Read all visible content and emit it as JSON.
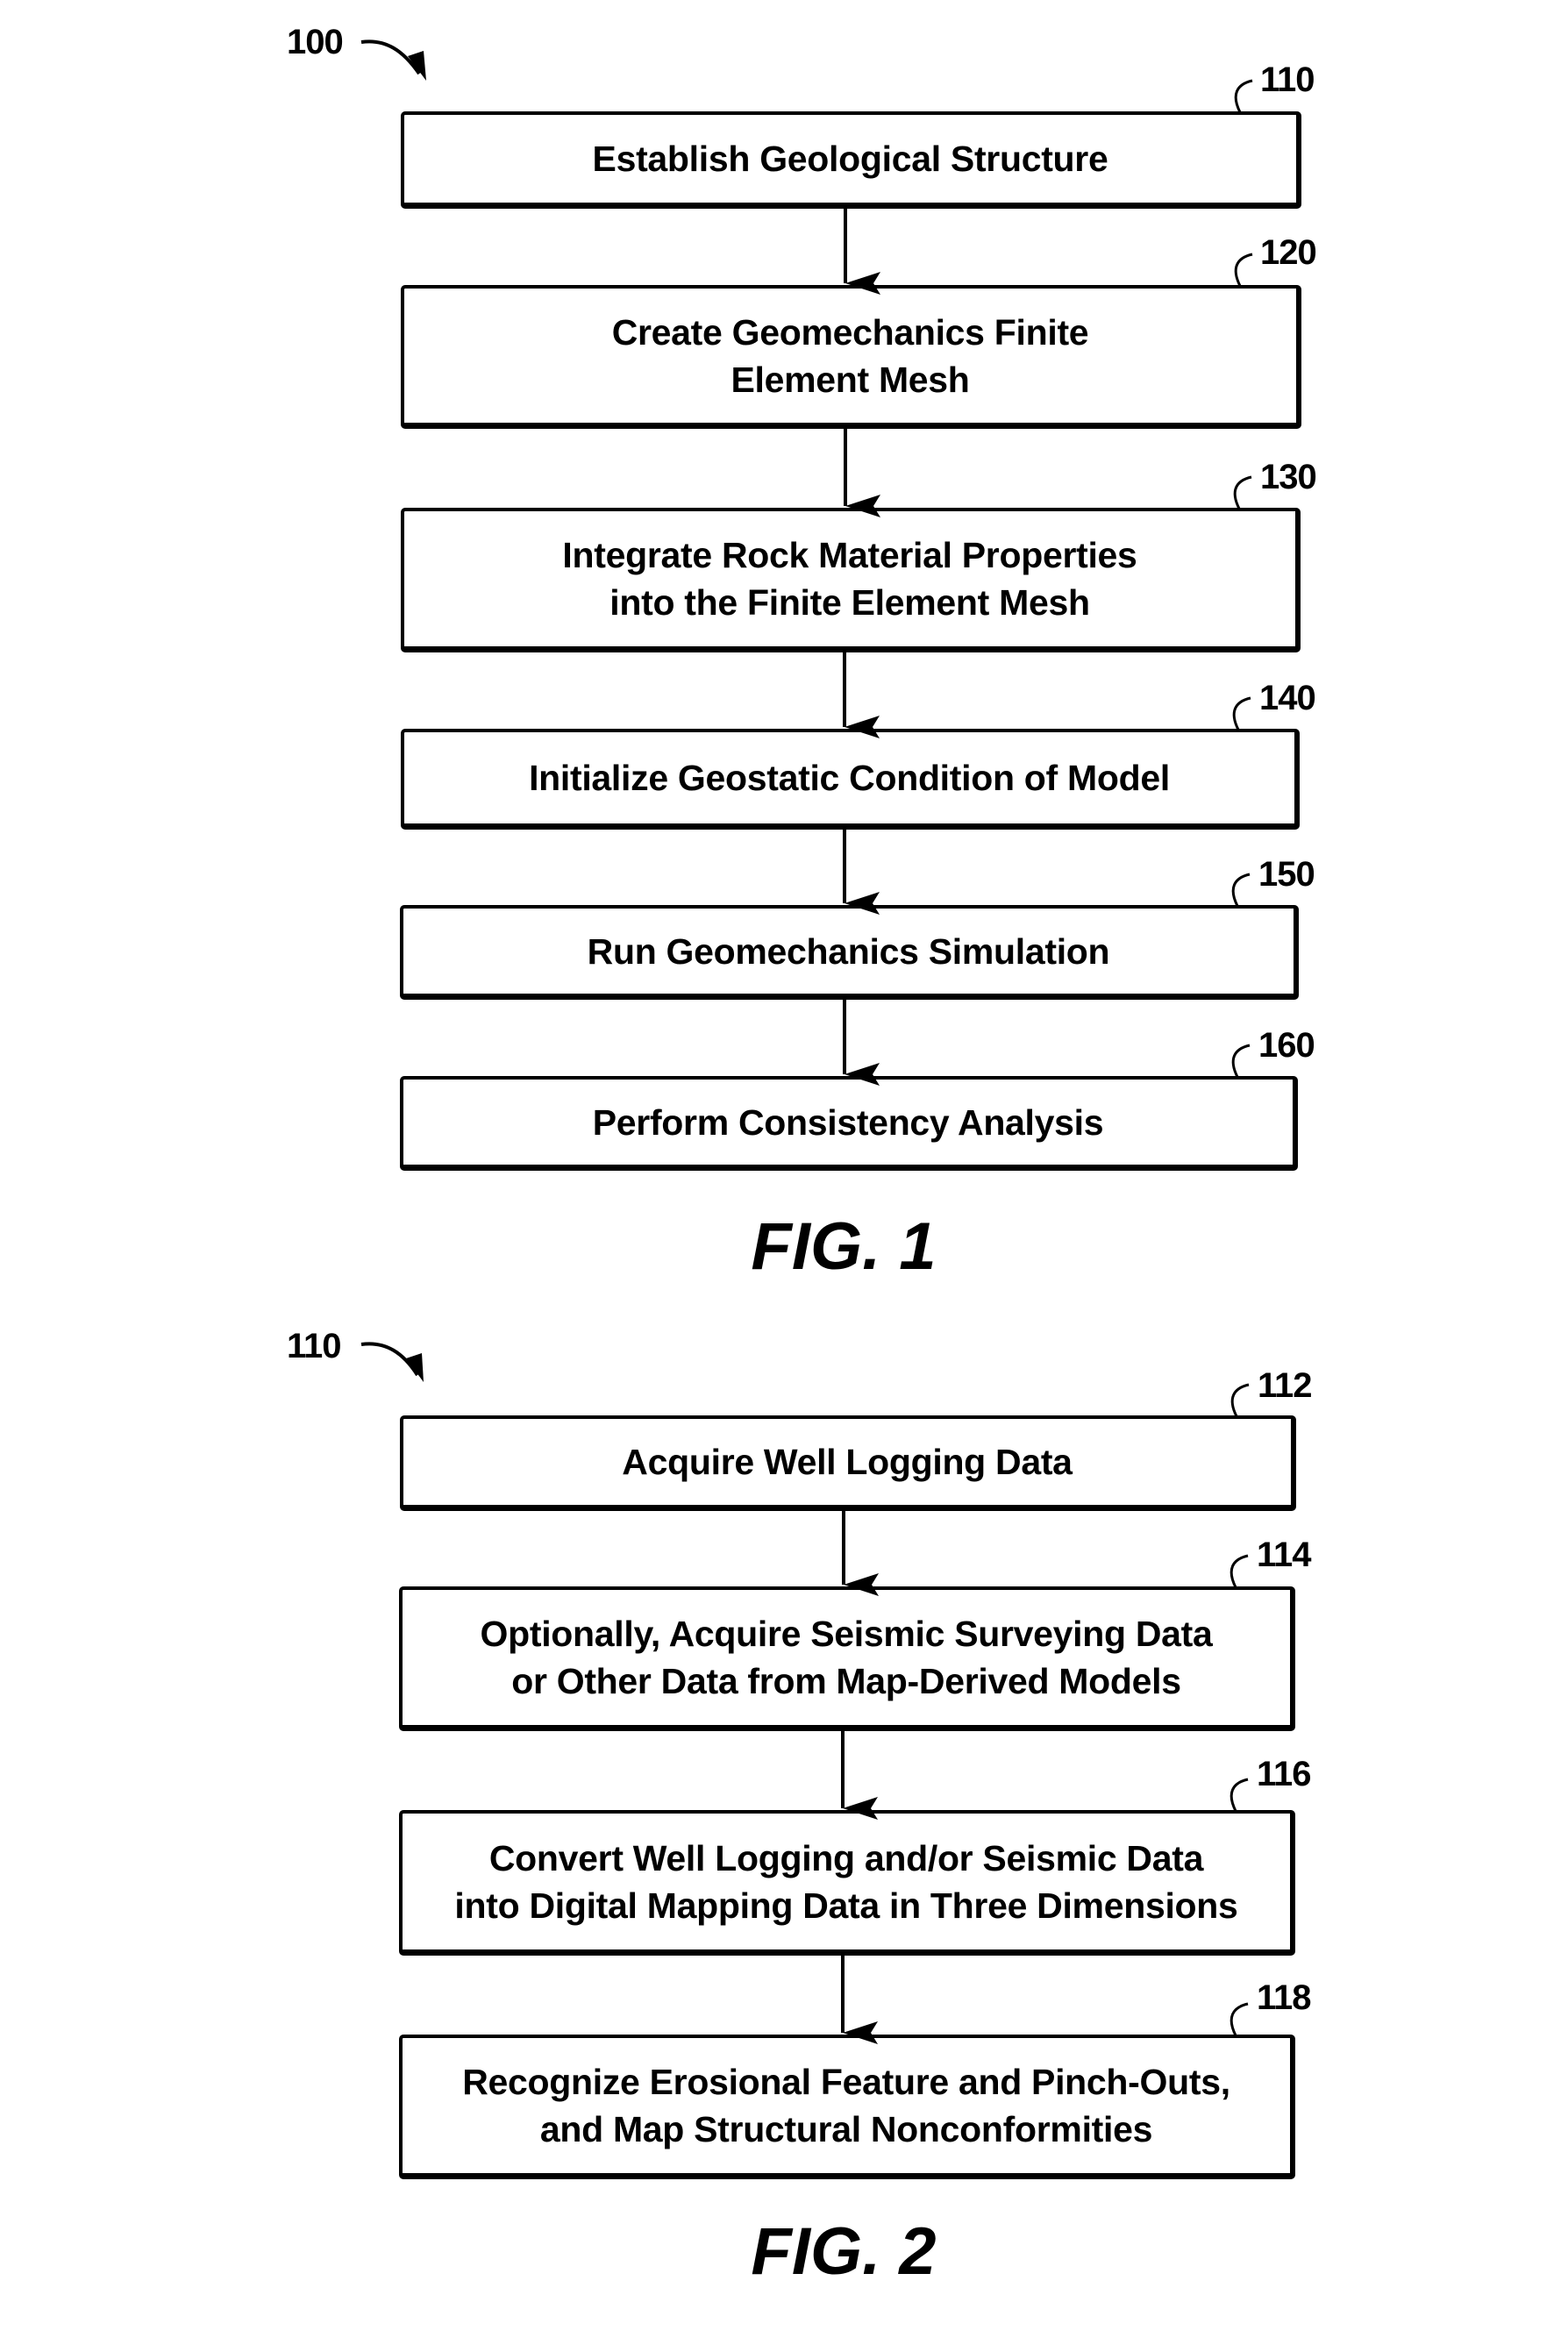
{
  "figures": [
    {
      "id": "fig1",
      "caption": "FIG. 1",
      "ref_label": "100",
      "steps": [
        {
          "ref": "110",
          "lines": [
            "Establish Geological Structure"
          ]
        },
        {
          "ref": "120",
          "lines": [
            "Create Geomechanics Finite",
            "Element Mesh"
          ]
        },
        {
          "ref": "130",
          "lines": [
            "Integrate Rock Material Properties",
            "into the Finite Element Mesh"
          ]
        },
        {
          "ref": "140",
          "lines": [
            "Initialize Geostatic Condition of Model"
          ]
        },
        {
          "ref": "150",
          "lines": [
            "Run Geomechanics Simulation"
          ]
        },
        {
          "ref": "160",
          "lines": [
            "Perform Consistency Analysis"
          ]
        }
      ]
    },
    {
      "id": "fig2",
      "caption": "FIG. 2",
      "ref_label": "110",
      "steps": [
        {
          "ref": "112",
          "lines": [
            "Acquire Well Logging Data"
          ]
        },
        {
          "ref": "114",
          "lines": [
            "Optionally, Acquire Seismic Surveying Data",
            "or Other Data from Map-Derived Models"
          ]
        },
        {
          "ref": "116",
          "lines": [
            "Convert Well Logging and/or Seismic Data",
            "into Digital Mapping Data in Three Dimensions"
          ]
        },
        {
          "ref": "118",
          "lines": [
            "Recognize Erosional Feature and Pinch-Outs,",
            "and Map Structural Nonconformities"
          ]
        }
      ]
    }
  ],
  "icons": {
    "flow_arrow": "down-arrow-icon",
    "reference_arrow": "curved-arrow-icon",
    "leader": "leader-hook-icon"
  },
  "colors": {
    "ink": "#000000",
    "paper": "#ffffff"
  }
}
